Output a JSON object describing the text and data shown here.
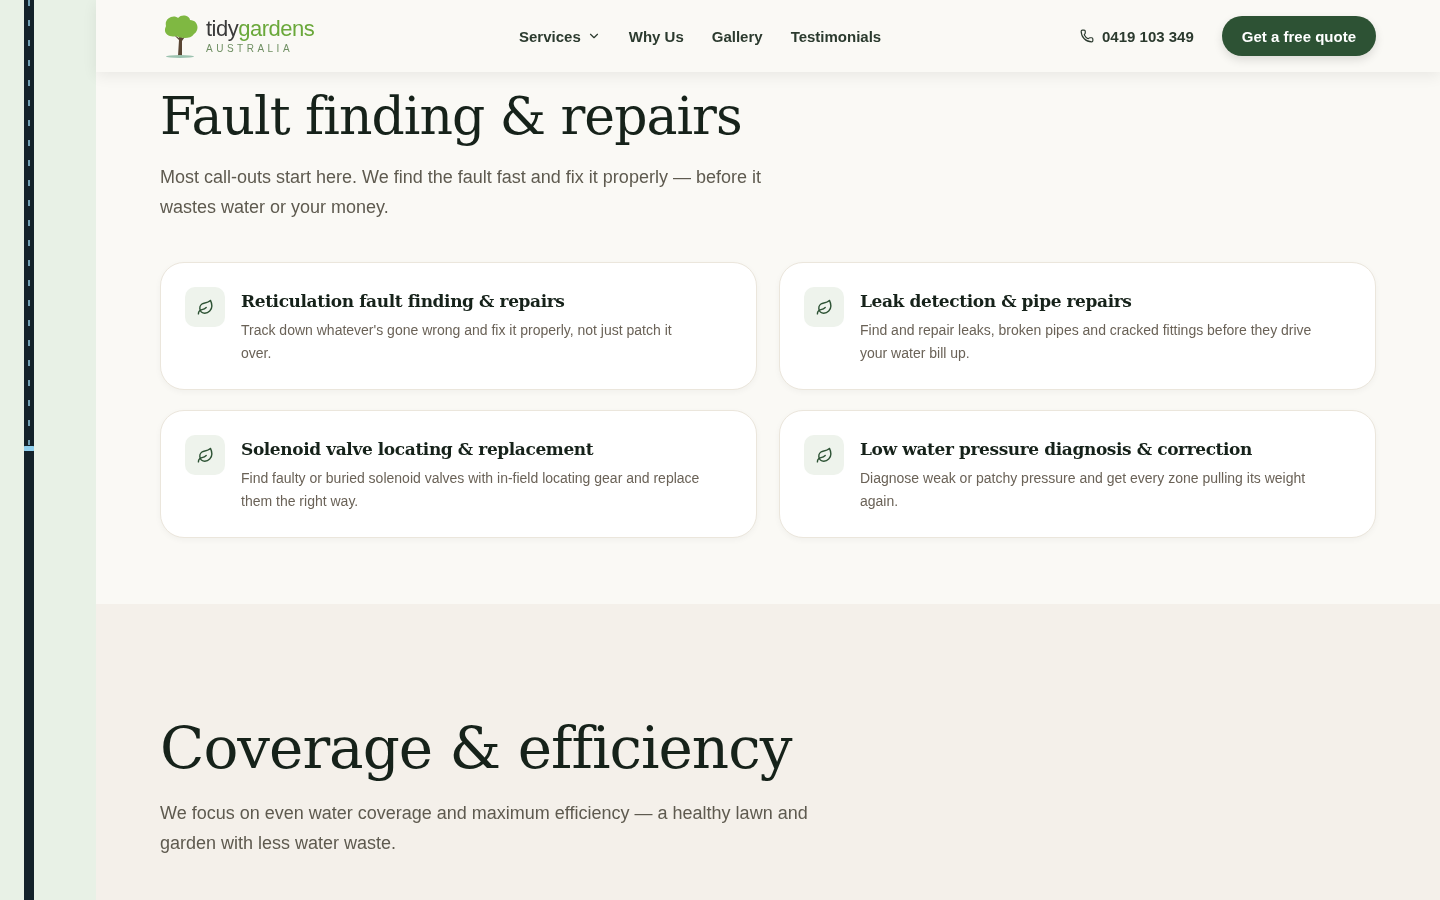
{
  "header": {
    "logo": {
      "name_dark": "tidy",
      "name_green": "gardens",
      "tagline": "AUSTRALIA"
    },
    "nav": [
      {
        "label": "Services",
        "dropdown": true
      },
      {
        "label": "Why Us",
        "dropdown": false
      },
      {
        "label": "Gallery",
        "dropdown": false
      },
      {
        "label": "Testimonials",
        "dropdown": false
      }
    ],
    "phone": "0419 103 349",
    "cta": "Get a free quote"
  },
  "fault_section": {
    "title": "Fault finding & repairs",
    "intro": "Most call-outs start here. We find the fault fast and fix it properly — before it wastes water or your money.",
    "cards": [
      {
        "title": "Reticulation fault finding & repairs",
        "text": "Track down whatever's gone wrong and fix it properly, not just patch it over."
      },
      {
        "title": "Leak detection & pipe repairs",
        "text": "Find and repair leaks, broken pipes and cracked fittings before they drive your water bill up."
      },
      {
        "title": "Solenoid valve locating & replacement",
        "text": "Find faulty or buried solenoid valves with in-field locating gear and replace them the right way."
      },
      {
        "title": "Low water pressure diagnosis & correction",
        "text": "Diagnose weak or patchy pressure and get every zone pulling its weight again."
      }
    ]
  },
  "coverage_section": {
    "title": "Coverage & efficiency",
    "intro": "We focus on even water coverage and maximum efficiency — a healthy lawn and garden with less water waste."
  }
}
